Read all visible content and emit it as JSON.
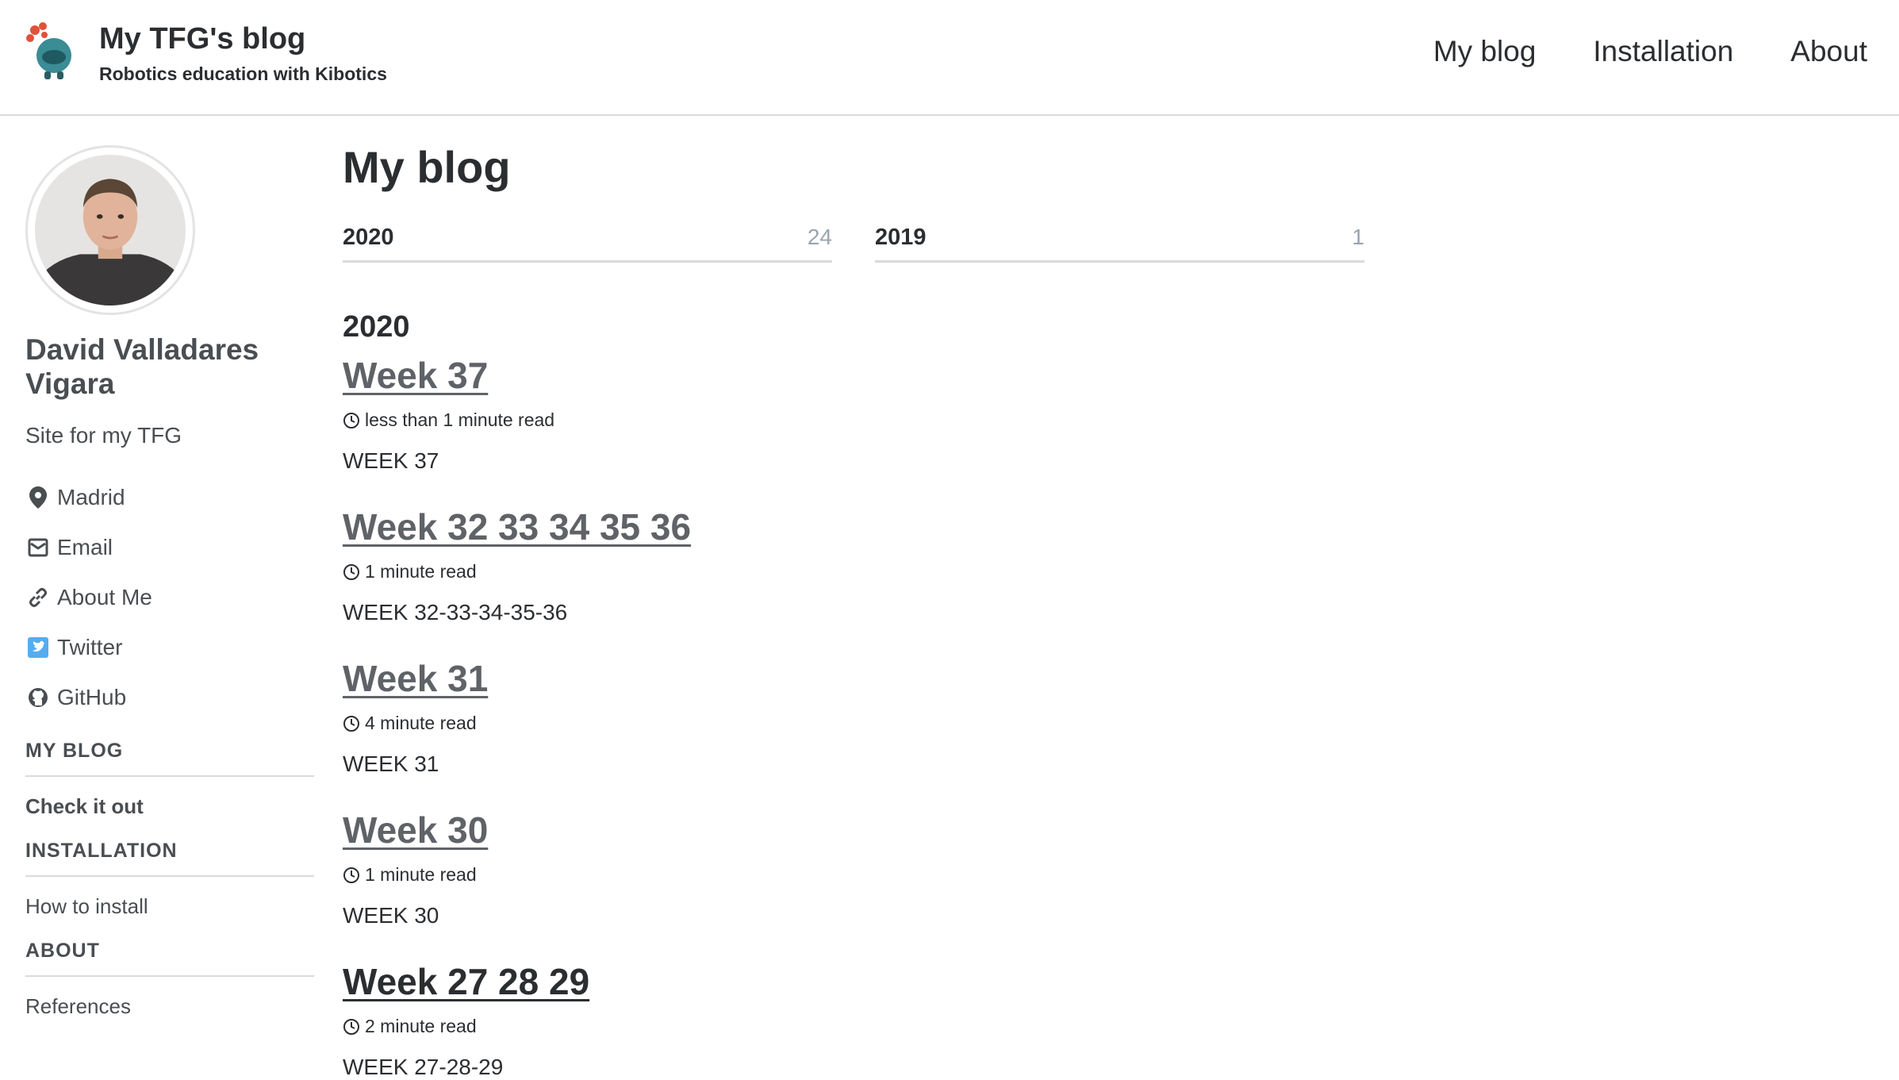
{
  "site": {
    "title": "My TFG's blog",
    "subtitle": "Robotics education with Kibotics"
  },
  "topnav": [
    {
      "label": "My blog"
    },
    {
      "label": "Installation"
    },
    {
      "label": "About"
    }
  ],
  "author": {
    "name": "David Valladares Vigara",
    "bio": "Site for my TFG",
    "links": [
      {
        "label": "Madrid",
        "icon": "map-marker-icon"
      },
      {
        "label": "Email",
        "icon": "envelope-icon"
      },
      {
        "label": "About Me",
        "icon": "link-icon"
      },
      {
        "label": "Twitter",
        "icon": "twitter-icon"
      },
      {
        "label": "GitHub",
        "icon": "github-icon"
      }
    ]
  },
  "sidebar_nav": [
    {
      "title": "MY BLOG",
      "item": "Check it out"
    },
    {
      "title": "INSTALLATION",
      "item": "How to install"
    },
    {
      "title": "ABOUT",
      "item": "References"
    }
  ],
  "main": {
    "title": "My blog",
    "years": [
      {
        "label": "2020",
        "count": "24"
      },
      {
        "label": "2019",
        "count": "1"
      }
    ],
    "year_heading": "2020",
    "posts": [
      {
        "title": "Week 37",
        "meta": "less than 1 minute read",
        "excerpt": "WEEK 37"
      },
      {
        "title": "Week 32 33 34 35 36",
        "meta": "1 minute read",
        "excerpt": "WEEK 32-33-34-35-36"
      },
      {
        "title": "Week 31",
        "meta": "4 minute read",
        "excerpt": "WEEK 31"
      },
      {
        "title": "Week 30",
        "meta": "1 minute read",
        "excerpt": "WEEK 30"
      },
      {
        "title": "Week 27 28 29",
        "meta": "2 minute read",
        "excerpt": "WEEK 27-28-29"
      }
    ]
  },
  "colors": {
    "text": "#494e52",
    "heading": "#2b2e31",
    "count": "#9aa4b2",
    "twitter": "#55acee",
    "border": "#d9dadc"
  }
}
